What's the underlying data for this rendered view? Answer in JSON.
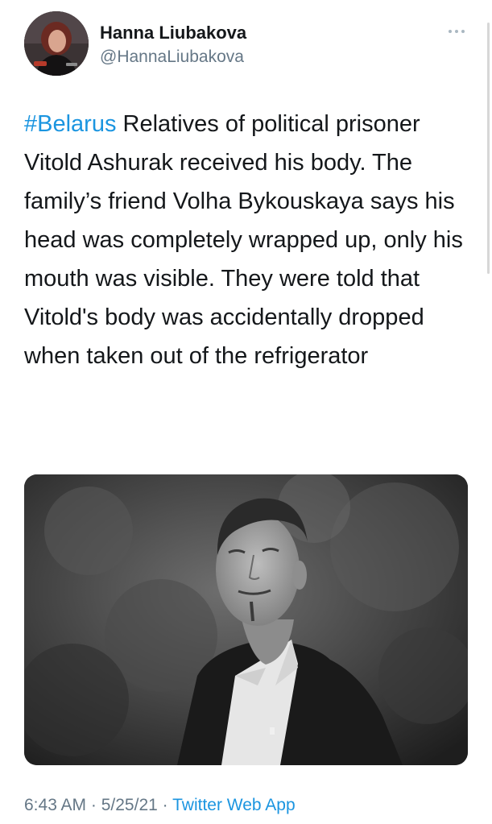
{
  "author": {
    "display_name": "Hanna Liubakova",
    "handle": "@HannaLiubakova",
    "avatar_icon": "profile-photo"
  },
  "more_icon": "more-horizontal-icon",
  "tweet": {
    "hashtag": "#Belarus",
    "body": " Relatives of political prisoner Vitold Ashurak received his body. The family’s friend Volha Bykouskaya says his head was completely wrapped up, only his mouth was visible. They were told that Vitold's body was accidentally dropped when taken out of the refrigerator"
  },
  "media": {
    "kind": "photo",
    "style": "black-and-white portrait"
  },
  "meta": {
    "time": "6:43 AM",
    "separator": " · ",
    "date": "5/25/21",
    "source": "Twitter Web App"
  },
  "colors": {
    "link": "#1b95e0",
    "secondary": "#657786",
    "text": "#14171a"
  }
}
